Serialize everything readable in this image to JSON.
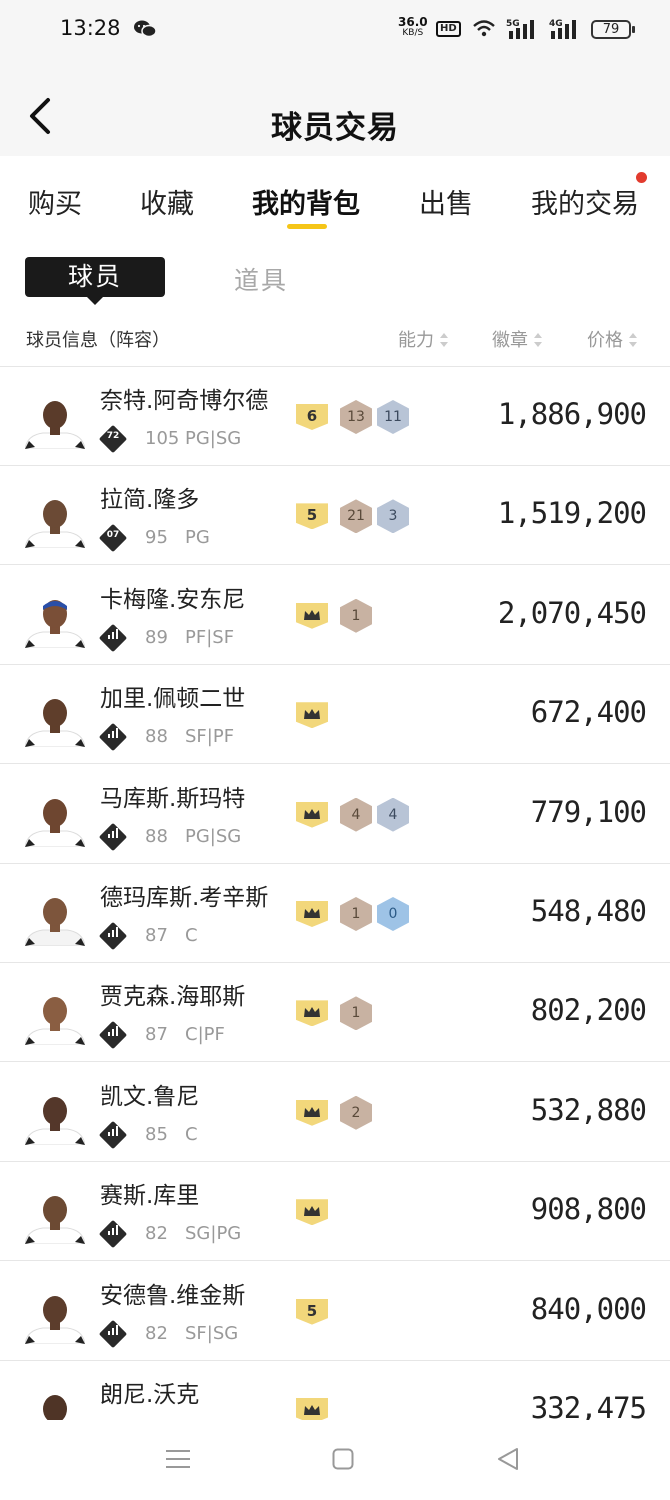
{
  "status_bar": {
    "time": "13:28",
    "speed": "36.0",
    "speed_unit": "KB/S",
    "hd": "HD",
    "battery": "79"
  },
  "header": {
    "title": "球员交易"
  },
  "tabs": [
    {
      "label": "购买"
    },
    {
      "label": "收藏"
    },
    {
      "label": "我的背包"
    },
    {
      "label": "出售"
    },
    {
      "label": "我的交易"
    }
  ],
  "subtabs": [
    {
      "label": "球员"
    },
    {
      "label": "道具"
    }
  ],
  "columns": {
    "info": "球员信息（阵容）",
    "ability": "能力",
    "badge": "徽章",
    "price": "价格"
  },
  "players": [
    {
      "name": "奈特.阿奇博尔德",
      "tier": "72",
      "ovr": "105",
      "pos": "PG|SG",
      "shield": "6",
      "hexes": [
        {
          "v": "13",
          "c": "bronze"
        },
        {
          "v": "11",
          "c": "silver"
        }
      ],
      "price": "1,886,900"
    },
    {
      "name": "拉简.隆多",
      "tier": "07",
      "ovr": "95",
      "pos": "PG",
      "shield": "5",
      "hexes": [
        {
          "v": "21",
          "c": "bronze"
        },
        {
          "v": "3",
          "c": "silver"
        }
      ],
      "price": "1,519,200"
    },
    {
      "name": "卡梅隆.安东尼",
      "tier": "",
      "ovr": "89",
      "pos": "PF|SF",
      "shield": "crown",
      "hexes": [
        {
          "v": "1",
          "c": "bronze"
        }
      ],
      "price": "2,070,450"
    },
    {
      "name": "加里.佩顿二世",
      "tier": "",
      "ovr": "88",
      "pos": "SF|PF",
      "shield": "crown",
      "hexes": [],
      "price": "672,400"
    },
    {
      "name": "马库斯.斯玛特",
      "tier": "",
      "ovr": "88",
      "pos": "PG|SG",
      "shield": "crown",
      "hexes": [
        {
          "v": "4",
          "c": "bronze"
        },
        {
          "v": "4",
          "c": "silver"
        }
      ],
      "price": "779,100"
    },
    {
      "name": "德玛库斯.考辛斯",
      "tier": "",
      "ovr": "87",
      "pos": "C",
      "shield": "crown",
      "hexes": [
        {
          "v": "1",
          "c": "bronze"
        },
        {
          "v": "0",
          "c": "blue"
        }
      ],
      "price": "548,480"
    },
    {
      "name": "贾克森.海耶斯",
      "tier": "",
      "ovr": "87",
      "pos": "C|PF",
      "shield": "crown",
      "hexes": [
        {
          "v": "1",
          "c": "bronze"
        }
      ],
      "price": "802,200"
    },
    {
      "name": "凯文.鲁尼",
      "tier": "",
      "ovr": "85",
      "pos": "C",
      "shield": "crown",
      "hexes": [
        {
          "v": "2",
          "c": "bronze"
        }
      ],
      "price": "532,880"
    },
    {
      "name": "赛斯.库里",
      "tier": "",
      "ovr": "82",
      "pos": "SG|PG",
      "shield": "crown",
      "hexes": [],
      "price": "908,800"
    },
    {
      "name": "安德鲁.维金斯",
      "tier": "",
      "ovr": "82",
      "pos": "SF|SG",
      "shield": "5",
      "hexes": [],
      "price": "840,000"
    },
    {
      "name": "朗尼.沃克",
      "tier": "",
      "ovr": "",
      "pos": "",
      "shield": "crown",
      "hexes": [],
      "price": "332,475"
    }
  ],
  "icons": {
    "back": "chevron-left-icon",
    "menu": "menu-icon",
    "home": "home-icon",
    "nav_back": "triangle-back-icon"
  },
  "colors": {
    "accent": "#f5c518",
    "shield": "#f2d77b",
    "notify_dot": "#e23b2e"
  }
}
